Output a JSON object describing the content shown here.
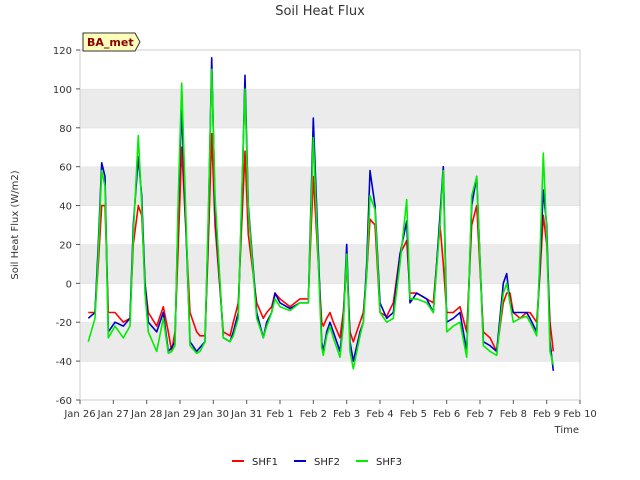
{
  "chart_data": {
    "type": "line",
    "title": "Soil Heat Flux",
    "xlabel": "Time",
    "ylabel": "Soil Heat Flux (W/m2)",
    "ylim": [
      -60,
      120
    ],
    "yticks": [
      -60,
      -40,
      -20,
      0,
      20,
      40,
      60,
      80,
      100,
      120
    ],
    "xlim": [
      0,
      15
    ],
    "xticks": [
      {
        "v": 0,
        "label": "Jan 26"
      },
      {
        "v": 1,
        "label": "Jan 27"
      },
      {
        "v": 2,
        "label": "Jan 28"
      },
      {
        "v": 3,
        "label": "Jan 29"
      },
      {
        "v": 4,
        "label": "Jan 30"
      },
      {
        "v": 5,
        "label": "Jan 31"
      },
      {
        "v": 6,
        "label": "Feb 1"
      },
      {
        "v": 7,
        "label": "Feb 2"
      },
      {
        "v": 8,
        "label": "Feb 3"
      },
      {
        "v": 9,
        "label": "Feb 4"
      },
      {
        "v": 10,
        "label": "Feb 5"
      },
      {
        "v": 11,
        "label": "Feb 6"
      },
      {
        "v": 12,
        "label": "Feb 7"
      },
      {
        "v": 13,
        "label": "Feb 8"
      },
      {
        "v": 14,
        "label": "Feb 9"
      },
      {
        "v": 15,
        "label": "Feb 10"
      }
    ],
    "grid": true,
    "legend_position": "bottom-center",
    "annotation": "BA_met",
    "series": [
      {
        "name": "SHF1",
        "color": "#ff0000",
        "x": [
          0.25,
          0.45,
          0.55,
          0.65,
          0.75,
          0.85,
          1.05,
          1.3,
          1.5,
          1.6,
          1.75,
          1.85,
          1.95,
          2.05,
          2.3,
          2.5,
          2.65,
          2.75,
          2.85,
          2.95,
          3.05,
          3.3,
          3.5,
          3.6,
          3.75,
          3.85,
          3.95,
          4.05,
          4.3,
          4.5,
          4.6,
          4.75,
          4.85,
          4.95,
          5.05,
          5.3,
          5.5,
          5.6,
          5.75,
          5.85,
          6.0,
          6.3,
          6.6,
          6.85,
          7.0,
          7.25,
          7.3,
          7.4,
          7.5,
          7.6,
          7.8,
          7.9,
          8.0,
          8.1,
          8.2,
          8.4,
          8.5,
          8.6,
          8.7,
          8.85,
          9.0,
          9.2,
          9.4,
          9.6,
          9.8,
          9.9,
          10.1,
          10.4,
          10.6,
          10.8,
          10.9,
          11.0,
          11.2,
          11.4,
          11.6,
          11.75,
          11.9,
          12.1,
          12.3,
          12.5,
          12.7,
          12.8,
          12.9,
          13.0,
          13.2,
          13.4,
          13.5,
          13.7,
          13.8,
          13.9,
          14.0,
          14.1,
          14.2
        ],
        "y": [
          -15,
          -15,
          10,
          40,
          40,
          -15,
          -15,
          -20,
          -18,
          20,
          40,
          35,
          0,
          -15,
          -22,
          -12,
          -25,
          -35,
          -25,
          20,
          70,
          -15,
          -25,
          -27,
          -27,
          20,
          77,
          30,
          -25,
          -27,
          -20,
          -10,
          30,
          68,
          25,
          -10,
          -18,
          -15,
          -12,
          -5,
          -8,
          -12,
          -8,
          -8,
          55,
          -20,
          -22,
          -18,
          -15,
          -20,
          -28,
          -15,
          10,
          -25,
          -30,
          -20,
          -15,
          5,
          33,
          30,
          -15,
          -17,
          -10,
          15,
          22,
          -5,
          -5,
          -8,
          -10,
          30,
          10,
          -15,
          -15,
          -12,
          -25,
          30,
          40,
          -25,
          -28,
          -35,
          -10,
          -5,
          -5,
          -15,
          -18,
          -15,
          -15,
          -20,
          5,
          35,
          20,
          -20,
          -35
        ]
      },
      {
        "name": "SHF2",
        "color": "#0000cc",
        "x": [
          0.25,
          0.45,
          0.55,
          0.65,
          0.75,
          0.85,
          1.05,
          1.3,
          1.5,
          1.6,
          1.75,
          1.85,
          1.95,
          2.05,
          2.3,
          2.5,
          2.65,
          2.75,
          2.85,
          2.95,
          3.05,
          3.3,
          3.5,
          3.6,
          3.75,
          3.85,
          3.95,
          4.05,
          4.3,
          4.5,
          4.6,
          4.75,
          4.85,
          4.95,
          5.05,
          5.3,
          5.5,
          5.6,
          5.75,
          5.85,
          6.0,
          6.3,
          6.6,
          6.85,
          7.0,
          7.25,
          7.3,
          7.4,
          7.5,
          7.6,
          7.8,
          7.9,
          8.0,
          8.1,
          8.2,
          8.4,
          8.5,
          8.6,
          8.7,
          8.85,
          9.0,
          9.2,
          9.4,
          9.6,
          9.8,
          9.9,
          10.1,
          10.4,
          10.6,
          10.8,
          10.9,
          11.0,
          11.2,
          11.4,
          11.6,
          11.75,
          11.9,
          12.1,
          12.3,
          12.5,
          12.7,
          12.8,
          12.9,
          13.0,
          13.2,
          13.4,
          13.5,
          13.7,
          13.8,
          13.9,
          14.0,
          14.1,
          14.2
        ],
        "y": [
          -18,
          -15,
          20,
          62,
          55,
          -25,
          -20,
          -22,
          -18,
          30,
          65,
          45,
          0,
          -20,
          -25,
          -15,
          -35,
          -33,
          -30,
          40,
          90,
          -30,
          -35,
          -33,
          -30,
          30,
          116,
          40,
          -28,
          -30,
          -25,
          -15,
          40,
          107,
          40,
          -15,
          -28,
          -20,
          -15,
          -5,
          -10,
          -13,
          -10,
          -10,
          85,
          -30,
          -35,
          -25,
          -20,
          -25,
          -35,
          -20,
          20,
          -30,
          -40,
          -25,
          -20,
          10,
          58,
          40,
          -10,
          -18,
          -15,
          15,
          32,
          -10,
          -5,
          -8,
          -15,
          35,
          60,
          -20,
          -18,
          -15,
          -35,
          40,
          55,
          -30,
          -32,
          -35,
          0,
          5,
          -10,
          -15,
          -15,
          -15,
          -18,
          -25,
          10,
          48,
          30,
          -30,
          -45
        ]
      },
      {
        "name": "SHF3",
        "color": "#00ee00",
        "x": [
          0.25,
          0.45,
          0.55,
          0.65,
          0.75,
          0.85,
          1.05,
          1.3,
          1.5,
          1.6,
          1.75,
          1.85,
          1.95,
          2.05,
          2.3,
          2.5,
          2.65,
          2.75,
          2.85,
          2.95,
          3.05,
          3.3,
          3.5,
          3.6,
          3.75,
          3.85,
          3.95,
          4.05,
          4.3,
          4.5,
          4.6,
          4.75,
          4.85,
          4.95,
          5.05,
          5.3,
          5.5,
          5.6,
          5.75,
          5.85,
          6.0,
          6.3,
          6.6,
          6.85,
          7.0,
          7.25,
          7.3,
          7.4,
          7.5,
          7.6,
          7.8,
          7.9,
          8.0,
          8.1,
          8.2,
          8.4,
          8.5,
          8.6,
          8.7,
          8.85,
          9.0,
          9.2,
          9.4,
          9.6,
          9.8,
          9.9,
          10.1,
          10.4,
          10.6,
          10.8,
          10.9,
          11.0,
          11.2,
          11.4,
          11.6,
          11.75,
          11.9,
          12.1,
          12.3,
          12.5,
          12.7,
          12.8,
          12.9,
          13.0,
          13.2,
          13.4,
          13.5,
          13.7,
          13.8,
          13.9,
          14.0,
          14.1,
          14.2
        ],
        "y": [
          -30,
          -18,
          15,
          58,
          50,
          -28,
          -22,
          -28,
          -22,
          25,
          76,
          40,
          -5,
          -25,
          -35,
          -18,
          -36,
          -35,
          -32,
          45,
          103,
          -32,
          -36,
          -35,
          -30,
          35,
          110,
          45,
          -28,
          -30,
          -27,
          -18,
          45,
          100,
          38,
          -18,
          -28,
          -22,
          -15,
          -8,
          -12,
          -14,
          -10,
          -10,
          75,
          -33,
          -37,
          -27,
          -22,
          -28,
          -38,
          -22,
          15,
          -35,
          -44,
          -27,
          -20,
          5,
          45,
          38,
          -15,
          -20,
          -18,
          10,
          43,
          -8,
          -8,
          -10,
          -15,
          30,
          58,
          -25,
          -22,
          -20,
          -38,
          45,
          55,
          -32,
          -35,
          -37,
          -5,
          0,
          -10,
          -20,
          -18,
          -17,
          -20,
          -27,
          15,
          67,
          25,
          -35,
          -42
        ]
      }
    ]
  }
}
